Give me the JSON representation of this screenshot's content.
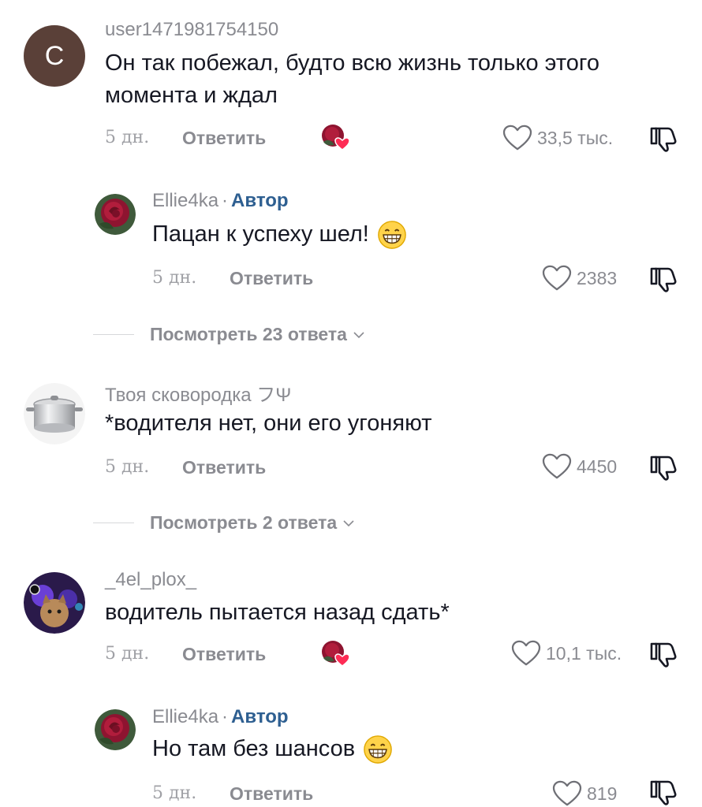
{
  "comments": [
    {
      "username": "user1471981754150",
      "avatar_letter": "C",
      "text": "Он так побежал, будто всю жизнь только этого момента и ждал",
      "time": "5 дн.",
      "reply_label": "Ответить",
      "likes": "33,5 тыс.",
      "creator_liked": true
    },
    {
      "username": "Ellie4ka",
      "author_label": "Автор",
      "text": "Пацан к успеху шел!",
      "emoji": "grin-emoji",
      "time": "5 дн.",
      "reply_label": "Ответить",
      "likes": "2383"
    },
    {
      "username": "Твоя сковородка フΨ",
      "text": "*водителя нет, они его угоняют",
      "time": "5 дн.",
      "reply_label": "Ответить",
      "likes": "4450"
    },
    {
      "username": "_4el_plox_",
      "text": "водитель пытается назад сдать*",
      "time": "5 дн.",
      "reply_label": "Ответить",
      "likes": "10,1 тыс.",
      "creator_liked": true
    },
    {
      "username": "Ellie4ka",
      "author_label": "Автор",
      "text": "Но там без шансов",
      "emoji": "grin-emoji",
      "time": "5 дн.",
      "reply_label": "Ответить",
      "likes": "819"
    }
  ],
  "view_replies": [
    {
      "label": "Посмотреть 23 ответа"
    },
    {
      "label": "Посмотреть 2 ответа"
    }
  ],
  "icons": {
    "like": "heart-outline-icon",
    "dislike": "thumbs-down-icon",
    "expand": "chevron-down-icon",
    "creator_liked": "creator-liked-badge-icon"
  },
  "colors": {
    "author": "#2e5f91",
    "muted": "#8a8b91",
    "text": "#161823"
  }
}
